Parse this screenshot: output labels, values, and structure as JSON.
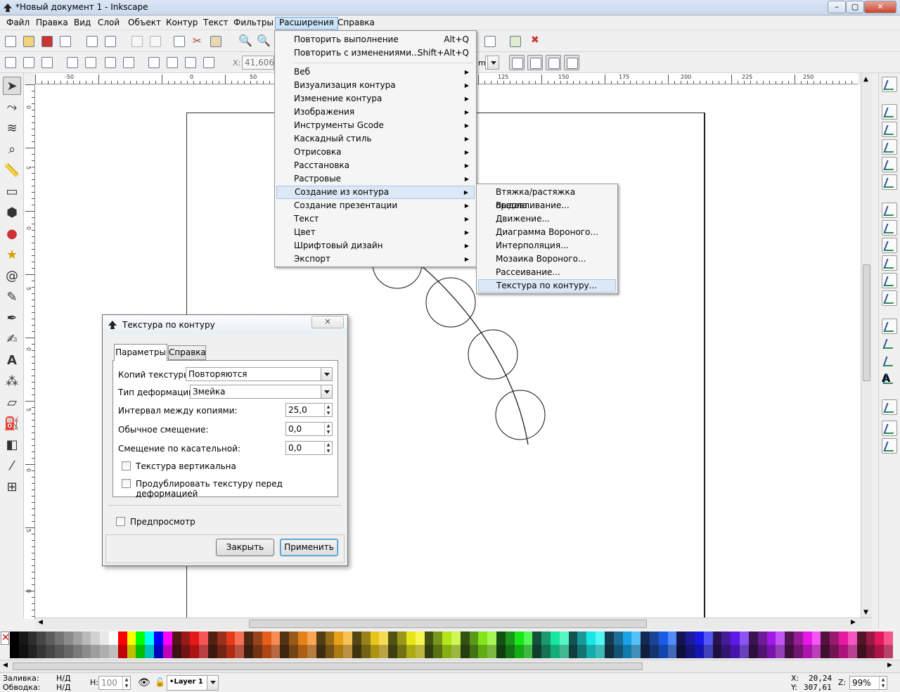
{
  "window": {
    "title": "*Новый документ 1 - Inkscape"
  },
  "menubar": [
    "Файл",
    "Правка",
    "Вид",
    "Слой",
    "Объект",
    "Контур",
    "Текст",
    "Фильтры",
    "Расширения",
    "Справка"
  ],
  "toolbar2": {
    "x_label": "X:",
    "x_value": "41,606",
    "unit": "m"
  },
  "extensions_menu": {
    "repeat": {
      "label": "Повторить выполнение",
      "shortcut": "Alt+Q"
    },
    "repeat_changes": {
      "label": "Повторить с изменениями...",
      "shortcut": "Shift+Alt+Q"
    },
    "items": [
      "Веб",
      "Визуализация контура",
      "Изменение контура",
      "Изображения",
      "Инструменты Gcode",
      "Каскадный стиль",
      "Отрисовка",
      "Расстановка",
      "Растровые",
      "Создание из контура",
      "Создание презентации",
      "Текст",
      "Цвет",
      "Шрифтовый дизайн",
      "Экспорт"
    ]
  },
  "submenu": [
    "Втяжка/растяжка ореола...",
    "Выдавливание...",
    "Движение...",
    "Диаграмма Вороного...",
    "Интерполяция...",
    "Мозаика Вороного...",
    "Рассеивание...",
    "Текстура по контуру..."
  ],
  "dialog": {
    "title": "Текстура по контуру",
    "tab_params": "Параметры",
    "tab_help": "Справка",
    "copies_label": "Копий текстуры:",
    "copies_value": "Повторяются",
    "deform_label": "Тип деформации:",
    "deform_value": "Змейка",
    "spacing_label": "Интервал между копиями:",
    "spacing_value": "25,0",
    "normal_label": "Обычное смещение:",
    "normal_value": "0,0",
    "tangent_label": "Смещение по касательной:",
    "tangent_value": "0,0",
    "vertical_label": "Текстура вертикальна",
    "duplicate_label": "Продублировать текстуру перед деформацией",
    "preview_label": "Предпросмотр",
    "close_btn": "Закрыть",
    "apply_btn": "Применить"
  },
  "ruler_h": [
    "-50",
    "0",
    "50",
    "100",
    "125",
    "150",
    "175",
    "200",
    "225",
    "250"
  ],
  "ruler_v": [
    "0",
    "5",
    "0",
    "5",
    "0",
    "5",
    "0",
    "5",
    "0",
    "5"
  ],
  "status": {
    "fill_label": "Заливка:",
    "fill_value": "Н/Д",
    "stroke_label": "Обводка:",
    "stroke_value": "Н/Д",
    "h_label": "H:",
    "h_value": "100",
    "layer": "•Layer 1",
    "x_label": "X:",
    "x_value": "20,24",
    "y_label": "Y:",
    "y_value": "307,61",
    "z_label": "Z:",
    "zoom": "99%"
  }
}
